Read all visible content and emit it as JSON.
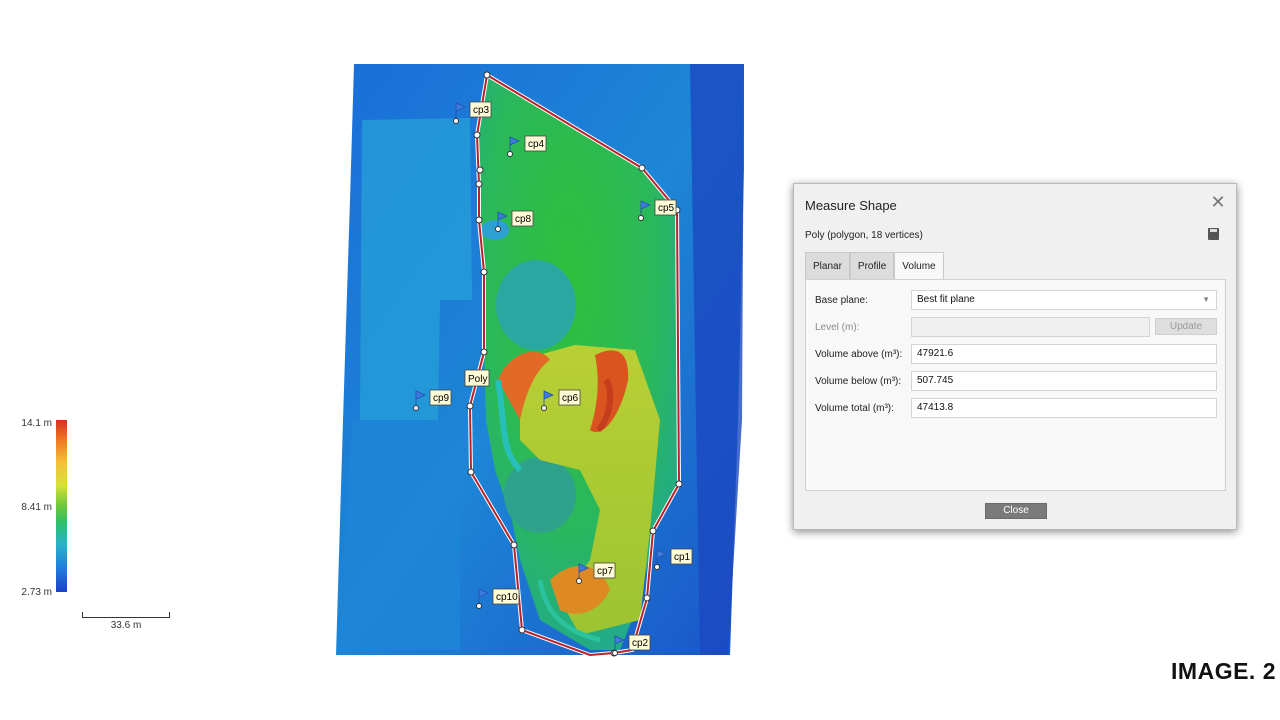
{
  "legend": {
    "max_label": "14.1 m",
    "mid_label": "8.41 m",
    "min_label": "2.73 m",
    "scale_label": "33.6 m"
  },
  "map": {
    "shape_label": "Poly",
    "markers": [
      "cp1",
      "cp2",
      "cp3",
      "cp4",
      "cp5",
      "cp6",
      "cp7",
      "cp8",
      "cp9",
      "cp10"
    ],
    "line_color": "#b8222c"
  },
  "dialog": {
    "title": "Measure Shape",
    "subtitle": "Poly (polygon, 18 vertices)",
    "tabs": [
      "Planar",
      "Profile",
      "Volume"
    ],
    "active_tab": "Volume",
    "base_plane_label": "Base plane:",
    "base_plane_value": "Best fit plane",
    "level_label": "Level (m):",
    "level_value": "",
    "update_label": "Update",
    "volume_above_label": "Volume above (m³):",
    "volume_above_value": "47921.6",
    "volume_below_label": "Volume below (m³):",
    "volume_below_value": "507.745",
    "volume_total_label": "Volume total (m³):",
    "volume_total_value": "47413.8",
    "close_label": "Close"
  },
  "footer_tag": "IMAGE. 2"
}
